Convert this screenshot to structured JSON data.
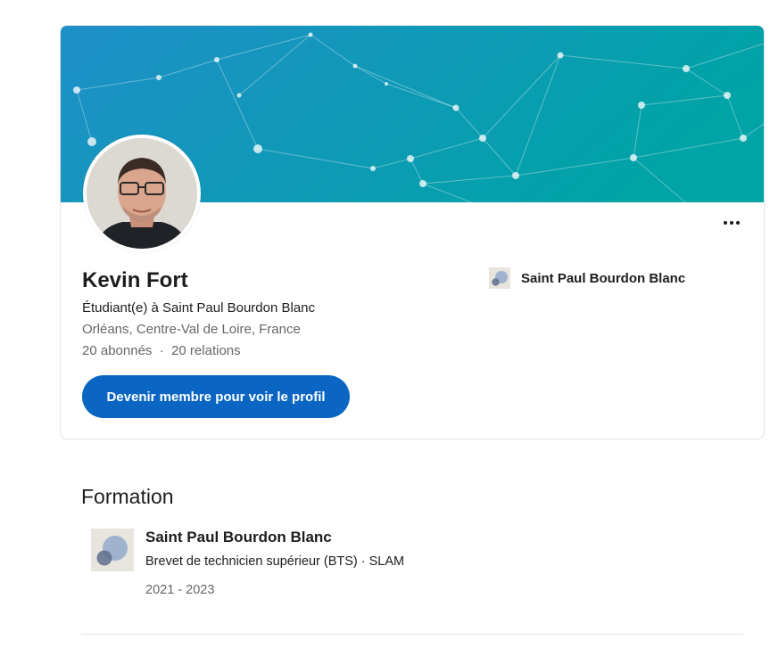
{
  "profile": {
    "name": "Kevin Fort",
    "headline": "Étudiant(e) à Saint Paul Bourdon Blanc",
    "location": "Orléans, Centre-Val de Loire, France",
    "followers": "20 abonnés",
    "separator": "  ·  ",
    "connections": "20 relations",
    "cta_label": "Devenir membre pour voir le profil",
    "school_link": "Saint Paul Bourdon Blanc"
  },
  "icons": {
    "more": "more-horizontal-icon",
    "school_logo": "school-logo-icon"
  },
  "colors": {
    "accent": "#0a66c2",
    "banner_start": "#1f8fc9",
    "banner_end": "#00a3a6"
  },
  "education": {
    "title": "Formation",
    "items": [
      {
        "school": "Saint Paul Bourdon Blanc",
        "degree": "Brevet de technicien supérieur (BTS) · SLAM",
        "dates": "2021 - 2023"
      }
    ]
  }
}
